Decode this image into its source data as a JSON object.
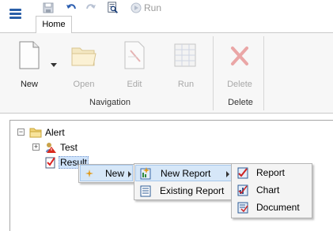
{
  "quick_access": {
    "run_label": "Run"
  },
  "tabs": [
    {
      "label": "Home"
    }
  ],
  "ribbon": {
    "buttons": {
      "new": "New",
      "open": "Open",
      "edit": "Edit",
      "run": "Run",
      "delete": "Delete"
    },
    "groups": {
      "navigation": "Navigation",
      "delete": "Delete"
    }
  },
  "tree": {
    "root": "Alert",
    "children": [
      "Test",
      "Result"
    ]
  },
  "context_menu": {
    "new": "New"
  },
  "submenu_new": {
    "new_report": "New Report",
    "existing_report": "Existing Report"
  },
  "submenu_report": {
    "report": "Report",
    "chart": "Chart",
    "document": "Document"
  },
  "colors": {
    "accent": "#2a5fa8",
    "ribbon_bg": "#f7f7f7",
    "highlight": "#d6e7f8",
    "selection": "#cfe3fb"
  },
  "icons": {
    "menu": "hamburger-icon",
    "save": "save-icon",
    "undo": "undo-icon",
    "redo": "redo-icon",
    "preview": "print-preview-icon",
    "run": "run-icon",
    "new": "new-document-icon",
    "open": "folder-icon",
    "edit": "edit-icon",
    "run_large": "grid-run-icon",
    "delete": "delete-x-icon"
  }
}
